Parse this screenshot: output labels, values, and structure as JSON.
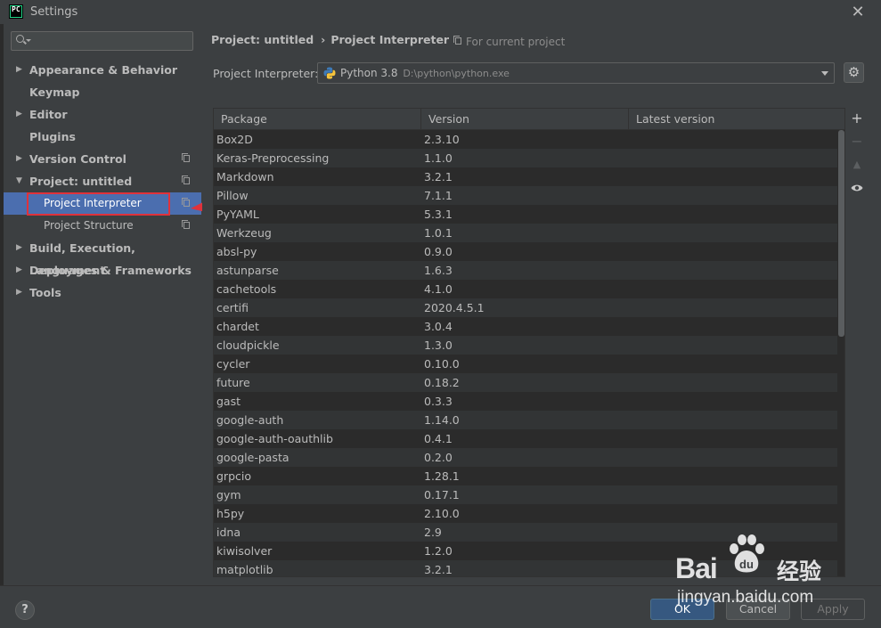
{
  "window": {
    "app_icon_text": "PC",
    "title": "Settings",
    "close_glyph": "✕"
  },
  "sidebar": {
    "search": {
      "value": "",
      "placeholder": ""
    },
    "items": [
      {
        "label": "Appearance & Behavior",
        "expandable": true,
        "expanded": false
      },
      {
        "label": "Keymap",
        "expandable": false
      },
      {
        "label": "Editor",
        "expandable": true,
        "expanded": false
      },
      {
        "label": "Plugins",
        "expandable": false
      },
      {
        "label": "Version Control",
        "expandable": true,
        "expanded": false,
        "scope_icon": true
      },
      {
        "label": "Project: untitled",
        "expandable": true,
        "expanded": true,
        "scope_icon": true
      },
      {
        "label": "Project Interpreter",
        "sub": true,
        "selected": true,
        "scope_icon": true
      },
      {
        "label": "Project Structure",
        "sub": true,
        "scope_icon": true
      },
      {
        "label": "Build, Execution, Deployment",
        "expandable": true,
        "expanded": false
      },
      {
        "label": "Languages & Frameworks",
        "expandable": true,
        "expanded": false
      },
      {
        "label": "Tools",
        "expandable": true,
        "expanded": false
      }
    ]
  },
  "main": {
    "breadcrumb": {
      "parent": "Project: untitled",
      "separator": "›",
      "current": "Project Interpreter"
    },
    "for_current_project": "For current project",
    "interpreter": {
      "label": "Project Interpreter:",
      "name": "Python 3.8",
      "path": "D:\\python\\python.exe"
    },
    "table": {
      "columns": [
        "Package",
        "Version",
        "Latest version"
      ],
      "rows": [
        [
          "Box2D",
          "2.3.10"
        ],
        [
          "Keras-Preprocessing",
          "1.1.0"
        ],
        [
          "Markdown",
          "3.2.1"
        ],
        [
          "Pillow",
          "7.1.1"
        ],
        [
          "PyYAML",
          "5.3.1"
        ],
        [
          "Werkzeug",
          "1.0.1"
        ],
        [
          "absl-py",
          "0.9.0"
        ],
        [
          "astunparse",
          "1.6.3"
        ],
        [
          "cachetools",
          "4.1.0"
        ],
        [
          "certifi",
          "2020.4.5.1"
        ],
        [
          "chardet",
          "3.0.4"
        ],
        [
          "cloudpickle",
          "1.3.0"
        ],
        [
          "cycler",
          "0.10.0"
        ],
        [
          "future",
          "0.18.2"
        ],
        [
          "gast",
          "0.3.3"
        ],
        [
          "google-auth",
          "1.14.0"
        ],
        [
          "google-auth-oauthlib",
          "0.4.1"
        ],
        [
          "google-pasta",
          "0.2.0"
        ],
        [
          "grpcio",
          "1.28.1"
        ],
        [
          "gym",
          "0.17.1"
        ],
        [
          "h5py",
          "2.10.0"
        ],
        [
          "idna",
          "2.9"
        ],
        [
          "kiwisolver",
          "1.2.0"
        ],
        [
          "matplotlib",
          "3.2.1"
        ]
      ]
    },
    "tools": {
      "add": "+",
      "remove": "−",
      "upgrade": "▲",
      "show_early": "eye-icon"
    }
  },
  "footer": {
    "help": "?",
    "ok": "OK",
    "cancel": "Cancel",
    "apply": "Apply"
  },
  "watermark": {
    "brand": "Bai",
    "brand_suffix": "经验",
    "paw_text": "du",
    "url": "jingyan.baidu.com"
  },
  "colors": {
    "selection": "#4b6eaf",
    "annotation": "#e0323b",
    "ok_button": "#365880"
  }
}
